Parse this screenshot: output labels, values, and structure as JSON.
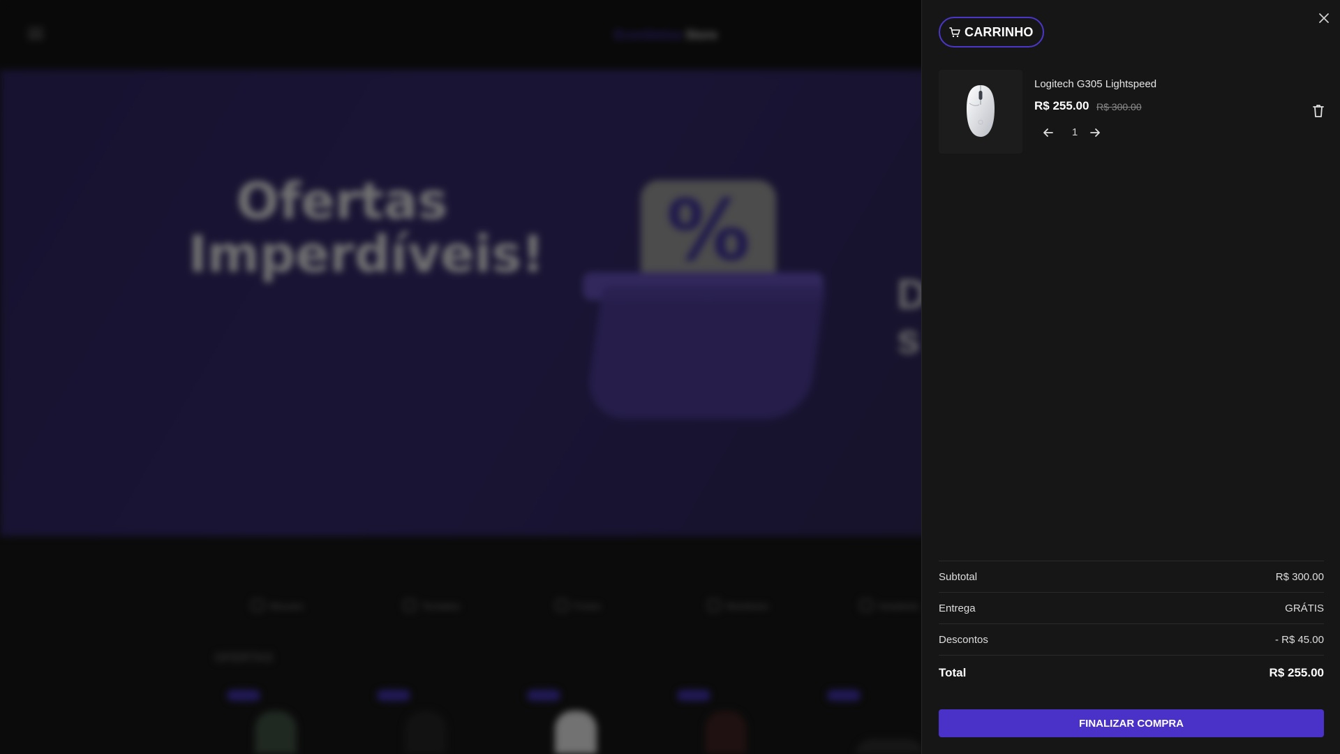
{
  "background": {
    "logo_part1": "Econômica",
    "logo_part2": "Store",
    "hero_line1": "Ofertas",
    "hero_line2": "Imperdíveis!",
    "hero_badge": "%",
    "categories": [
      "Mouses",
      "Teclados",
      "Fones",
      "Monitores",
      "Headsets"
    ],
    "section_title": "OFERTAS"
  },
  "cart": {
    "title": "CARRINHO",
    "items": [
      {
        "name": "Logitech G305 Lightspeed",
        "price": "R$ 255.00",
        "old_price": "R$ 300.00",
        "quantity": "1"
      }
    ],
    "summary": {
      "subtotal_label": "Subtotal",
      "subtotal_value": "R$ 300.00",
      "shipping_label": "Entrega",
      "shipping_value": "GRÁTIS",
      "discount_label": "Descontos",
      "discount_value": "- R$ 45.00",
      "total_label": "Total",
      "total_value": "R$ 255.00"
    },
    "checkout_label": "FINALIZAR COMPRA"
  },
  "colors": {
    "accent": "#4a32c8",
    "drawer_bg": "#161616"
  }
}
